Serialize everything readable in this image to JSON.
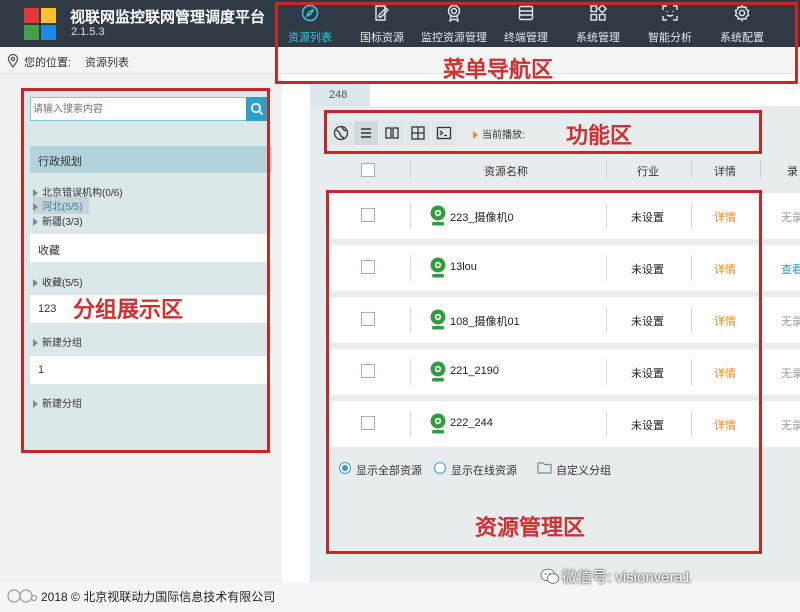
{
  "app": {
    "title": "视联网监控联网管理调度平台",
    "version": "2.1.5.3",
    "logo_colors": [
      "#e53935",
      "#fbc02d",
      "#43a047",
      "#1e88e5"
    ]
  },
  "nav": {
    "items": [
      {
        "label": "资源列表",
        "icon": "compass-icon",
        "active": true
      },
      {
        "label": "国标资源",
        "icon": "edit-doc-icon",
        "active": false
      },
      {
        "label": "监控资源管理",
        "icon": "medal-icon",
        "active": false
      },
      {
        "label": "终端管理",
        "icon": "server-icon",
        "active": false
      },
      {
        "label": "系统管理",
        "icon": "grid-icon",
        "active": false
      },
      {
        "label": "智能分析",
        "icon": "scan-face-icon",
        "active": false
      },
      {
        "label": "系统配置",
        "icon": "gear-icon",
        "active": false
      }
    ]
  },
  "breadcrumb": {
    "prefix": "您的位置:",
    "current": "资源列表"
  },
  "sidebar": {
    "search_placeholder": "请输入搜索内容",
    "region_header": "行政规划",
    "tree": [
      {
        "label": "北京错误机构(0/6)"
      },
      {
        "label": "河北(5/5)",
        "selected": true
      },
      {
        "label": "新疆(3/3)"
      }
    ],
    "groups": [
      {
        "name": "收藏"
      },
      {
        "tree_label": "收藏(5/5)"
      },
      {
        "name": "123"
      },
      {
        "tree_label": "新建分组"
      },
      {
        "name": "1"
      },
      {
        "tree_label": "新建分组"
      }
    ]
  },
  "main": {
    "tab": "248",
    "toolbar": {
      "buttons": [
        "globe-icon",
        "list-icon",
        "two-column-icon",
        "four-grid-icon",
        "terminal-icon"
      ],
      "playing_label": "当前播放:"
    },
    "table": {
      "columns": [
        "资源名称",
        "行业",
        "详情",
        "录"
      ],
      "rows": [
        {
          "name": "223_摄像机0",
          "industry": "未设置",
          "detail": "详情",
          "record": "无录",
          "record_link": false
        },
        {
          "name": "13lou",
          "industry": "未设置",
          "detail": "详情",
          "record": "查看",
          "record_link": true
        },
        {
          "name": "108_摄像机01",
          "industry": "未设置",
          "detail": "详情",
          "record": "无录",
          "record_link": false
        },
        {
          "name": "221_2190",
          "industry": "未设置",
          "detail": "详情",
          "record": "无录",
          "record_link": false
        },
        {
          "name": "222_244",
          "industry": "未设置",
          "detail": "详情",
          "record": "无录",
          "record_link": false
        }
      ]
    },
    "filters": {
      "show_all": "显示全部资源",
      "show_online": "显示在线资源",
      "custom_group": "自定义分组",
      "selected": "show_all"
    }
  },
  "annotations": {
    "menu": "菜单导航区",
    "function": "功能区",
    "group": "分组展示区",
    "resource": "资源管理区"
  },
  "footer": {
    "copyright": "2018 © 北京视联动力国际信息技术有限公司",
    "wechat": "微信号: visionvera1"
  },
  "colors": {
    "header_bg": "#2f3a45",
    "active_nav": "#38c4e8",
    "accent_blue": "#2f9fc8",
    "detail_orange": "#f08a1c",
    "annotation_red": "#c62828",
    "camera_green": "#2e9e3a"
  }
}
